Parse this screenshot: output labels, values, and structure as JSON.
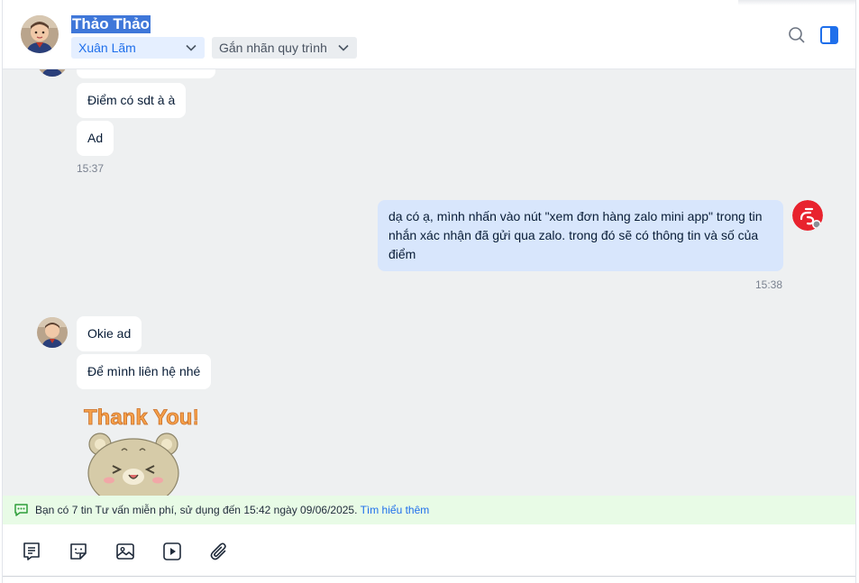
{
  "header": {
    "contact_name": "Thảo Thảo",
    "tag_primary": "Xuân Lãm",
    "tag_workflow": "Gắn nhãn quy trình",
    "icons": [
      "search-icon",
      "sidebar-toggle-icon"
    ]
  },
  "messages": [
    {
      "side": "in",
      "text": "Điểm có sdt à à"
    },
    {
      "side": "in",
      "text": "Ad"
    },
    {
      "side": "in",
      "time": "15:37"
    },
    {
      "side": "out",
      "text": "dạ có ạ, mình nhấn vào nút \"xem đơn hàng zalo mini app\" trong tin nhắn xác nhận đã gửi qua zalo. trong đó sẽ có thông tin và số của điểm",
      "time": "15:38"
    },
    {
      "side": "in",
      "text": "Okie ad"
    },
    {
      "side": "in",
      "text": "Để mình liên hệ nhé"
    },
    {
      "side": "in",
      "sticker": "Thank You!"
    }
  ],
  "promo": {
    "text": "Bạn có 7 tin Tư vấn miễn phí, sử dụng đến 15:42 ngày 09/06/2025.",
    "link": "Tìm hiểu thêm"
  },
  "toolbar": {
    "icons": [
      "quick-message-icon",
      "sticker-icon",
      "image-icon",
      "video-icon",
      "attachment-icon"
    ]
  },
  "colors": {
    "accent": "#1f6feb",
    "chat_bg": "#eef0f1",
    "outgoing_bubble": "#d8e6fc",
    "promo_bg": "#e8fbe6",
    "brand_red": "#e8232e"
  }
}
